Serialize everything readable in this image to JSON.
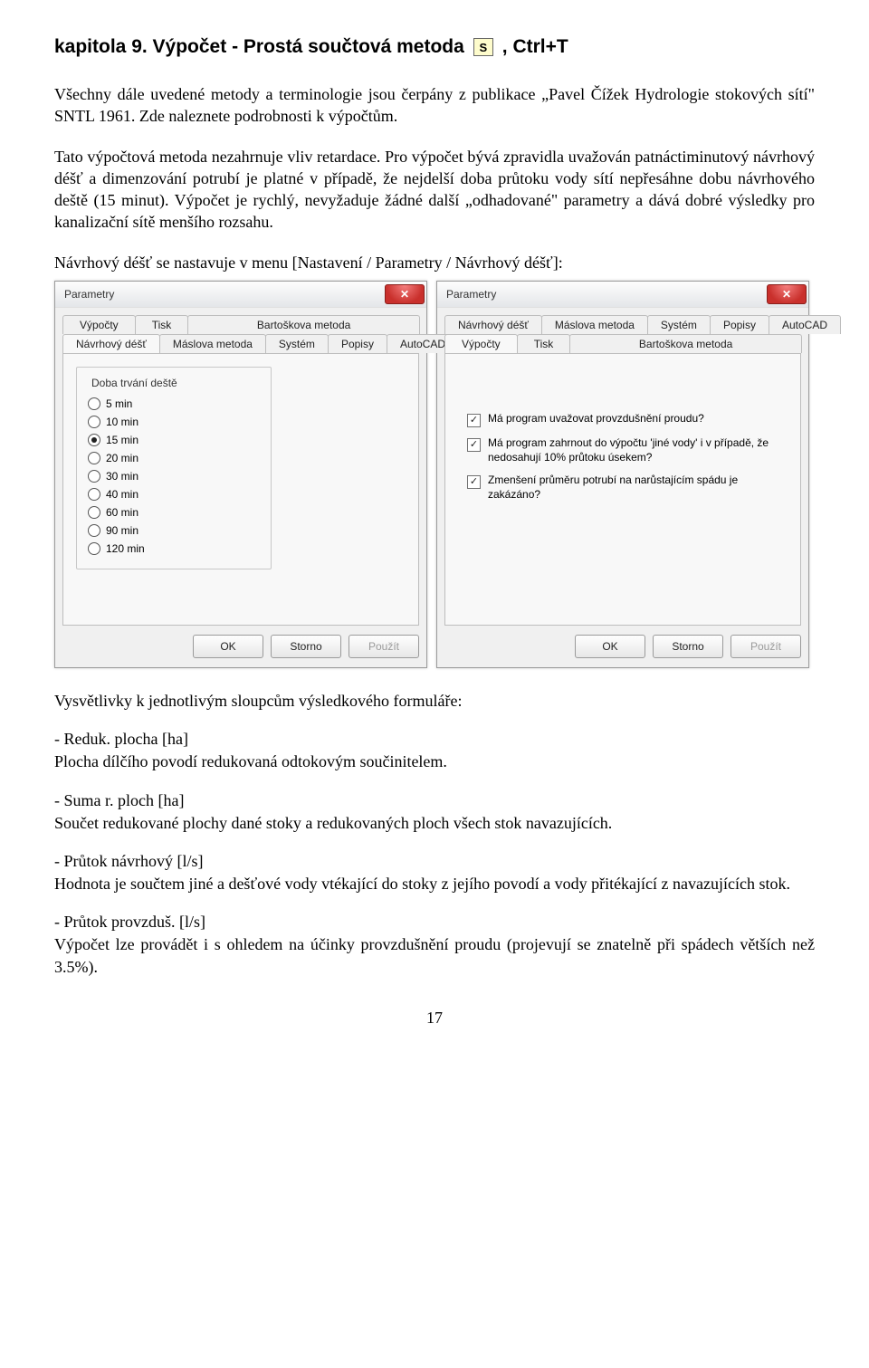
{
  "heading": {
    "prefix": "kapitola 9. Výpočet - Prostá součtová metoda",
    "icon_letter": "S",
    "suffix": ", Ctrl+T"
  },
  "para1": "Všechny dále uvedené metody a terminologie jsou čerpány z publikace „Pavel Čížek Hydrologie stokových sítí\" SNTL 1961. Zde naleznete podrobnosti k výpočtům.",
  "para2": "Tato výpočtová metoda nezahrnuje vliv retardace. Pro výpočet bývá zpravidla uvažován patnáctiminutový návrhový déšť a dimenzování potrubí je platné v případě, že nejdelší doba průtoku vody sítí nepřesáhne dobu návrhového deště (15 minut). Výpočet je rychlý, nevyžaduje žádné další „odhadované\" parametry a dává dobré výsledky pro kanalizační sítě menšího rozsahu.",
  "para3": "Návrhový déšť se nastavuje v menu  [Nastavení / Parametry / Návrhový déšť]:",
  "dialog_left": {
    "title": "Parametry",
    "tabs_upper": [
      "Výpočty",
      "Tisk",
      "Bartoškova metoda"
    ],
    "tabs_lower": [
      "Návrhový déšť",
      "Máslova metoda",
      "Systém",
      "Popisy",
      "AutoCAD"
    ],
    "active_tab": "Návrhový déšť",
    "group_title": "Doba trvání deště",
    "radios": [
      {
        "label": "5 min",
        "sel": false
      },
      {
        "label": "10 min",
        "sel": false
      },
      {
        "label": "15 min",
        "sel": true
      },
      {
        "label": "20 min",
        "sel": false
      },
      {
        "label": "30 min",
        "sel": false
      },
      {
        "label": "40 min",
        "sel": false
      },
      {
        "label": "60 min",
        "sel": false
      },
      {
        "label": "90 min",
        "sel": false
      },
      {
        "label": "120 min",
        "sel": false
      }
    ],
    "buttons": {
      "ok": "OK",
      "cancel": "Storno",
      "apply": "Použít"
    }
  },
  "dialog_right": {
    "title": "Parametry",
    "tabs_upper": [
      "Návrhový déšť",
      "Máslova metoda",
      "Systém",
      "Popisy",
      "AutoCAD"
    ],
    "tabs_lower": [
      "Výpočty",
      "Tisk",
      "Bartoškova metoda"
    ],
    "active_tab": "Výpočty",
    "checks": [
      {
        "label": "Má program uvažovat provzdušnění proudu?",
        "checked": true
      },
      {
        "label": "Má program zahrnout do výpočtu 'jiné vody' i v případě, že nedosahují 10% průtoku úsekem?",
        "checked": true
      },
      {
        "label": "Zmenšení průměru potrubí na narůstajícím spádu je zakázáno?",
        "checked": true
      }
    ],
    "buttons": {
      "ok": "OK",
      "cancel": "Storno",
      "apply": "Použít"
    }
  },
  "para4": "Vysvětlivky k jednotlivým sloupcům výsledkového formuláře:",
  "terms": [
    {
      "t": "- Reduk. plocha [ha]",
      "d": "Plocha dílčího povodí redukovaná odtokovým součinitelem."
    },
    {
      "t": "- Suma r. ploch [ha]",
      "d": "Součet redukované plochy dané stoky a redukovaných ploch všech stok navazujících."
    },
    {
      "t": "- Průtok návrhový [l/s]",
      "d": "Hodnota je součtem jiné a dešťové vody vtékající do stoky z jejího povodí a vody přitékající z navazujících stok."
    },
    {
      "t": "- Průtok provzduš. [l/s]",
      "d": "Výpočet lze provádět i s ohledem na účinky provzdušnění proudu (projevují se znatelně při spádech větších než 3.5%)."
    }
  ],
  "page_number": "17"
}
